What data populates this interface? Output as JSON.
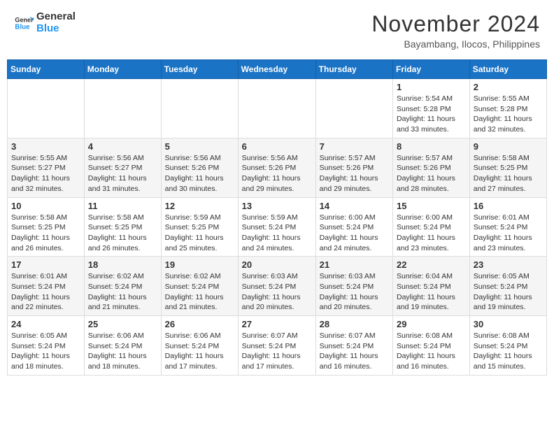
{
  "header": {
    "logo_line1": "General",
    "logo_line2": "Blue",
    "month": "November 2024",
    "location": "Bayambang, Ilocos, Philippines"
  },
  "weekdays": [
    "Sunday",
    "Monday",
    "Tuesday",
    "Wednesday",
    "Thursday",
    "Friday",
    "Saturday"
  ],
  "weeks": [
    [
      {
        "day": "",
        "info": ""
      },
      {
        "day": "",
        "info": ""
      },
      {
        "day": "",
        "info": ""
      },
      {
        "day": "",
        "info": ""
      },
      {
        "day": "",
        "info": ""
      },
      {
        "day": "1",
        "info": "Sunrise: 5:54 AM\nSunset: 5:28 PM\nDaylight: 11 hours and 33 minutes."
      },
      {
        "day": "2",
        "info": "Sunrise: 5:55 AM\nSunset: 5:28 PM\nDaylight: 11 hours and 32 minutes."
      }
    ],
    [
      {
        "day": "3",
        "info": "Sunrise: 5:55 AM\nSunset: 5:27 PM\nDaylight: 11 hours and 32 minutes."
      },
      {
        "day": "4",
        "info": "Sunrise: 5:56 AM\nSunset: 5:27 PM\nDaylight: 11 hours and 31 minutes."
      },
      {
        "day": "5",
        "info": "Sunrise: 5:56 AM\nSunset: 5:26 PM\nDaylight: 11 hours and 30 minutes."
      },
      {
        "day": "6",
        "info": "Sunrise: 5:56 AM\nSunset: 5:26 PM\nDaylight: 11 hours and 29 minutes."
      },
      {
        "day": "7",
        "info": "Sunrise: 5:57 AM\nSunset: 5:26 PM\nDaylight: 11 hours and 29 minutes."
      },
      {
        "day": "8",
        "info": "Sunrise: 5:57 AM\nSunset: 5:26 PM\nDaylight: 11 hours and 28 minutes."
      },
      {
        "day": "9",
        "info": "Sunrise: 5:58 AM\nSunset: 5:25 PM\nDaylight: 11 hours and 27 minutes."
      }
    ],
    [
      {
        "day": "10",
        "info": "Sunrise: 5:58 AM\nSunset: 5:25 PM\nDaylight: 11 hours and 26 minutes."
      },
      {
        "day": "11",
        "info": "Sunrise: 5:58 AM\nSunset: 5:25 PM\nDaylight: 11 hours and 26 minutes."
      },
      {
        "day": "12",
        "info": "Sunrise: 5:59 AM\nSunset: 5:25 PM\nDaylight: 11 hours and 25 minutes."
      },
      {
        "day": "13",
        "info": "Sunrise: 5:59 AM\nSunset: 5:24 PM\nDaylight: 11 hours and 24 minutes."
      },
      {
        "day": "14",
        "info": "Sunrise: 6:00 AM\nSunset: 5:24 PM\nDaylight: 11 hours and 24 minutes."
      },
      {
        "day": "15",
        "info": "Sunrise: 6:00 AM\nSunset: 5:24 PM\nDaylight: 11 hours and 23 minutes."
      },
      {
        "day": "16",
        "info": "Sunrise: 6:01 AM\nSunset: 5:24 PM\nDaylight: 11 hours and 23 minutes."
      }
    ],
    [
      {
        "day": "17",
        "info": "Sunrise: 6:01 AM\nSunset: 5:24 PM\nDaylight: 11 hours and 22 minutes."
      },
      {
        "day": "18",
        "info": "Sunrise: 6:02 AM\nSunset: 5:24 PM\nDaylight: 11 hours and 21 minutes."
      },
      {
        "day": "19",
        "info": "Sunrise: 6:02 AM\nSunset: 5:24 PM\nDaylight: 11 hours and 21 minutes."
      },
      {
        "day": "20",
        "info": "Sunrise: 6:03 AM\nSunset: 5:24 PM\nDaylight: 11 hours and 20 minutes."
      },
      {
        "day": "21",
        "info": "Sunrise: 6:03 AM\nSunset: 5:24 PM\nDaylight: 11 hours and 20 minutes."
      },
      {
        "day": "22",
        "info": "Sunrise: 6:04 AM\nSunset: 5:24 PM\nDaylight: 11 hours and 19 minutes."
      },
      {
        "day": "23",
        "info": "Sunrise: 6:05 AM\nSunset: 5:24 PM\nDaylight: 11 hours and 19 minutes."
      }
    ],
    [
      {
        "day": "24",
        "info": "Sunrise: 6:05 AM\nSunset: 5:24 PM\nDaylight: 11 hours and 18 minutes."
      },
      {
        "day": "25",
        "info": "Sunrise: 6:06 AM\nSunset: 5:24 PM\nDaylight: 11 hours and 18 minutes."
      },
      {
        "day": "26",
        "info": "Sunrise: 6:06 AM\nSunset: 5:24 PM\nDaylight: 11 hours and 17 minutes."
      },
      {
        "day": "27",
        "info": "Sunrise: 6:07 AM\nSunset: 5:24 PM\nDaylight: 11 hours and 17 minutes."
      },
      {
        "day": "28",
        "info": "Sunrise: 6:07 AM\nSunset: 5:24 PM\nDaylight: 11 hours and 16 minutes."
      },
      {
        "day": "29",
        "info": "Sunrise: 6:08 AM\nSunset: 5:24 PM\nDaylight: 11 hours and 16 minutes."
      },
      {
        "day": "30",
        "info": "Sunrise: 6:08 AM\nSunset: 5:24 PM\nDaylight: 11 hours and 15 minutes."
      }
    ]
  ]
}
